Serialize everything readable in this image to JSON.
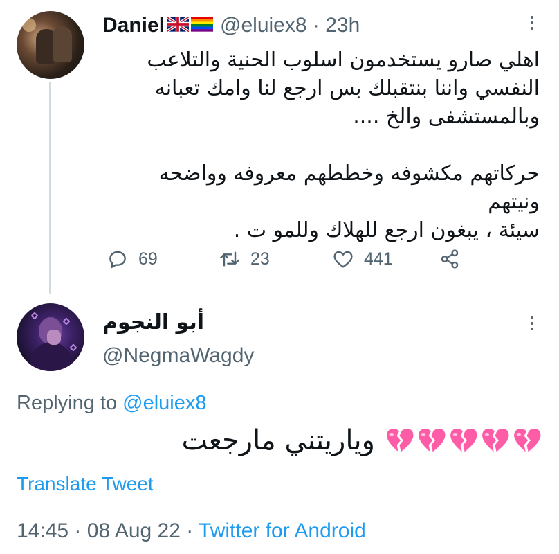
{
  "parent_tweet": {
    "display_name": "Daniel",
    "flags": [
      "uk-flag",
      "rainbow-flag"
    ],
    "handle": "@eluiex8",
    "time": "23h",
    "body_lines": [
      "اهلي صارو يستخدمون اسلوب الحنية  والتلاعب",
      "النفسي واننا بنتقبلك بس ارجع لنا وامك تعبانه",
      "وبالمستشفى والخ ....",
      "",
      "حركاتهم مكشوفه وخططهم معروفه وواضحه ونيتهم",
      "سيئة ، يبغون ارجع للهلاك وللمو ت ."
    ],
    "replies": "69",
    "retweets": "23",
    "likes": "441"
  },
  "reply_tweet": {
    "display_name": "أبو النجوم",
    "handle": "@NegmaWagdy",
    "replying_label": "Replying to",
    "replying_handle": "@eluiex8",
    "text": "وياريتني مارجعت",
    "emoji_count": 5,
    "emoji_name": "broken-heart",
    "translate_label": "Translate Tweet",
    "time": "14:45",
    "date": "08 Aug 22",
    "source": "Twitter for Android",
    "separator": "·"
  },
  "colors": {
    "text": "#0f1419",
    "secondary": "#536471",
    "link": "#1d9bf0",
    "thread_line": "#cfd9de",
    "broken_heart": "#ff5ca8"
  }
}
